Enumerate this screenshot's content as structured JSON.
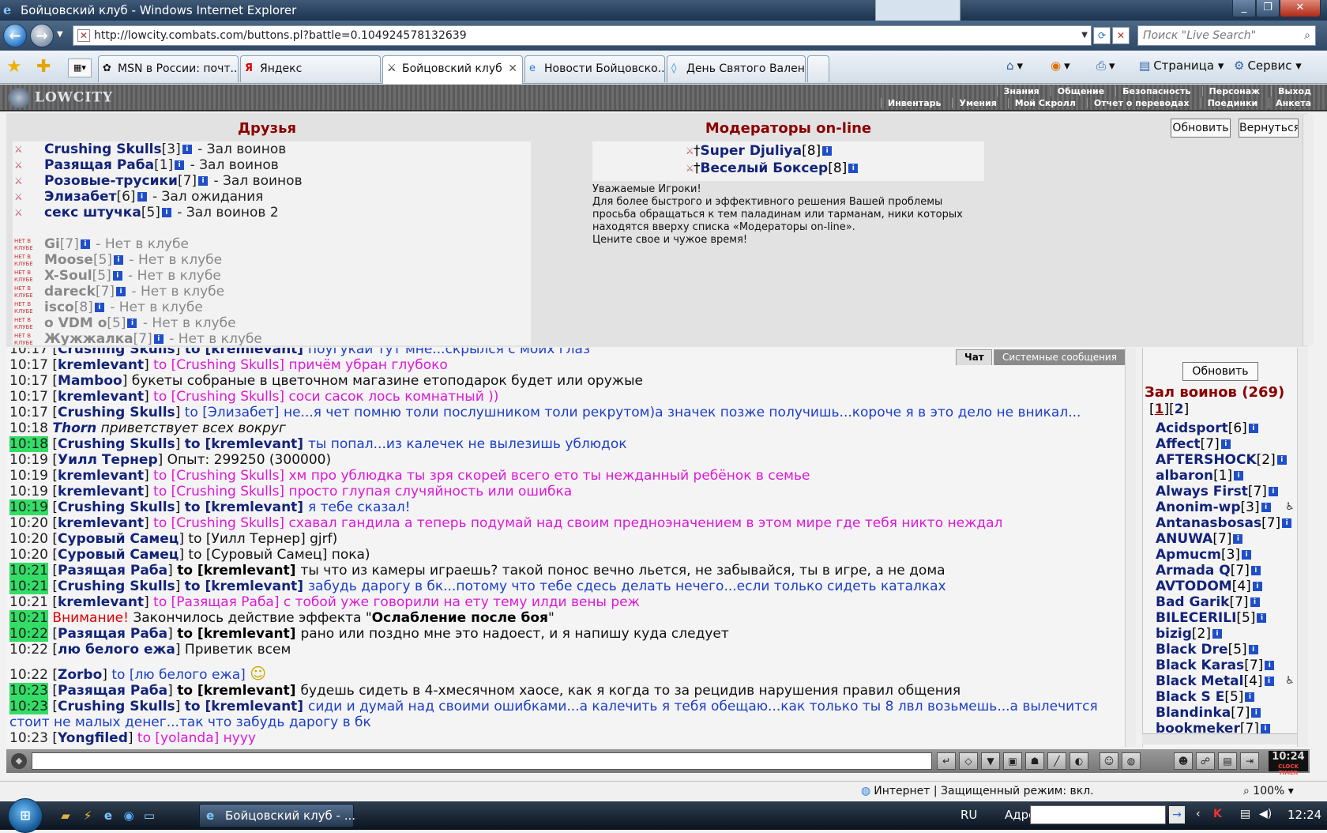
{
  "window": {
    "title": "Бойцовский клуб - Windows Internet Explorer",
    "url": "http://lowcity.combats.com/buttons.pl?battle=0.104924578132639",
    "search_placeholder": "Поиск \"Live Search\""
  },
  "tabs": [
    {
      "label": "MSN в России: почт...",
      "icon": "msn-icon"
    },
    {
      "label": "Яндекс",
      "icon": "yandex-icon"
    },
    {
      "label": "Бойцовский клуб",
      "icon": "combats-icon"
    },
    {
      "label": "Новости Бойцовско...",
      "icon": "ie-icon"
    },
    {
      "label": "День Святого Вален...",
      "icon": "ie-icon"
    }
  ],
  "commands": {
    "page": "Страница",
    "service": "Сервис"
  },
  "game": {
    "logo": "LOWCITY",
    "menu_row1": [
      "Знания",
      "Общение",
      "Безопасность",
      "Персонаж",
      "Выход"
    ],
    "menu_row2": [
      "Инвентарь",
      "Умения",
      "Мой Скролл",
      "Отчет о переводах",
      "Поединки",
      "Анкета"
    ]
  },
  "friends": {
    "title": "Друзья",
    "online": [
      {
        "name": "Crushing Skulls",
        "level": "[3]",
        "status": " - Зал воинов"
      },
      {
        "name": "Разящая Раба",
        "level": "[1]",
        "status": " - Зал воинов"
      },
      {
        "name": "Розовые-трусики",
        "level": "[7]",
        "status": " - Зал воинов"
      },
      {
        "name": "Элизабет",
        "level": "[6]",
        "status": " - Зал ожидания"
      },
      {
        "name": "секс штучка",
        "level": "[5]",
        "status": " - Зал воинов 2"
      }
    ],
    "offline": [
      {
        "name": "Gi",
        "level": "[7]",
        "status": " - Нет в клубе"
      },
      {
        "name": "Moose",
        "level": "[5]",
        "status": " - Нет в клубе"
      },
      {
        "name": "X-Soul",
        "level": "[5]",
        "status": " - Нет в клубе"
      },
      {
        "name": "dareck",
        "level": "[7]",
        "status": " - Нет в клубе"
      },
      {
        "name": "isco",
        "level": "[8]",
        "status": " - Нет в клубе"
      },
      {
        "name": "o VDM o",
        "level": "[5]",
        "status": " - Нет в клубе"
      },
      {
        "name": "Жужжалка",
        "level": "[7]",
        "status": " - Нет в клубе"
      }
    ]
  },
  "moderators": {
    "title": "Модераторы on-line",
    "list": [
      {
        "name": "Super Djuliya",
        "level": "[8]"
      },
      {
        "name": "Веселый Боксер",
        "level": "[8]"
      }
    ],
    "notice": [
      "Уважаемые Игроки!",
      "Для более быстрого и эффективного решения Вашей проблемы",
      "просьба обращаться к тем паладинам или тарманам, ники которых",
      "находятся вверху списка «Модераторы on-line».",
      "Цените свое и чужое время!"
    ]
  },
  "buttons": {
    "update": "Обновить",
    "return": "Вернуться"
  },
  "chat_tabs": {
    "chat": "Чат",
    "system": "Системные сообщения"
  },
  "chat": [
    {
      "t": "10:17",
      "hl": false,
      "parts": [
        [
          "[",
          "txt"
        ],
        [
          "Crushing Skulls",
          "nm"
        ],
        [
          "] ",
          "txt"
        ],
        [
          "to [kremlevant] ",
          "nmb"
        ],
        [
          "поугукай тут мне...скрылся с моих глаз",
          "blue"
        ]
      ]
    },
    {
      "t": "10:17",
      "hl": false,
      "parts": [
        [
          "[",
          "txt"
        ],
        [
          "kremlevant",
          "nm"
        ],
        [
          "] ",
          "txt"
        ],
        [
          "to [Crushing Skulls] причём убран глубоко",
          "pink"
        ]
      ]
    },
    {
      "t": "10:17",
      "hl": false,
      "parts": [
        [
          "[",
          "txt"
        ],
        [
          "Mamboo",
          "nm"
        ],
        [
          "] букеты собраные в цветочном магазине етоподарок будет или оружые",
          "txt"
        ]
      ]
    },
    {
      "t": "10:17",
      "hl": false,
      "parts": [
        [
          "[",
          "txt"
        ],
        [
          "kremlevant",
          "nm"
        ],
        [
          "] ",
          "txt"
        ],
        [
          "to [Crushing Skulls] соси сасок лось комнатный ))",
          "pink"
        ]
      ]
    },
    {
      "t": "10:17",
      "hl": false,
      "parts": [
        [
          "[",
          "txt"
        ],
        [
          "Crushing Skulls",
          "nm"
        ],
        [
          "] ",
          "txt"
        ],
        [
          "to [Элизабет] не...я чет помню толи послушником толи рекрутом)а значек позже получишь...короче я в это дело не вникал...",
          "blue"
        ]
      ]
    },
    {
      "t": "10:18",
      "hl": false,
      "parts": [
        [
          "Thorn",
          "nmi"
        ],
        [
          " приветствует всех вокруг",
          "it"
        ]
      ]
    },
    {
      "t": "10:18",
      "hl": true,
      "parts": [
        [
          "[",
          "txt"
        ],
        [
          "Crushing Skulls",
          "nm"
        ],
        [
          "] ",
          "txt"
        ],
        [
          "to [kremlevant] ",
          "nmb"
        ],
        [
          "ты попал...из калечек не вылезишь ублюдок",
          "blue"
        ]
      ]
    },
    {
      "t": "10:19",
      "hl": false,
      "parts": [
        [
          "[",
          "txt"
        ],
        [
          "Уилл Тернер",
          "nm"
        ],
        [
          "] Опыт: 299250 (300000)",
          "txt"
        ]
      ]
    },
    {
      "t": "10:19",
      "hl": false,
      "parts": [
        [
          "[",
          "txt"
        ],
        [
          "kremlevant",
          "nm"
        ],
        [
          "] ",
          "txt"
        ],
        [
          "to [Crushing Skulls] хм про ублюдка ты зря скорей всего ето ты нежданный ребёнок в семье",
          "pink"
        ]
      ]
    },
    {
      "t": "10:19",
      "hl": false,
      "parts": [
        [
          "[",
          "txt"
        ],
        [
          "kremlevant",
          "nm"
        ],
        [
          "] ",
          "txt"
        ],
        [
          "to [Crushing Skulls] просто глупая случяйность или ошибка",
          "pink"
        ]
      ]
    },
    {
      "t": "10:19",
      "hl": true,
      "parts": [
        [
          "[",
          "txt"
        ],
        [
          "Crushing Skulls",
          "nm"
        ],
        [
          "] ",
          "txt"
        ],
        [
          "to [kremlevant] ",
          "nmb"
        ],
        [
          "я тебе сказал!",
          "blue"
        ]
      ]
    },
    {
      "t": "10:20",
      "hl": false,
      "parts": [
        [
          "[",
          "txt"
        ],
        [
          "kremlevant",
          "nm"
        ],
        [
          "] ",
          "txt"
        ],
        [
          "to [Crushing Skulls] схавал гандила а теперь подумай над своим предноэначением в этом мире где тебя никто неждал",
          "pink"
        ]
      ]
    },
    {
      "t": "10:20",
      "hl": false,
      "parts": [
        [
          "[",
          "txt"
        ],
        [
          "Суровый Самец",
          "nm"
        ],
        [
          "] to [Уилл Тернер] gjrf)",
          "txt"
        ]
      ]
    },
    {
      "t": "10:20",
      "hl": false,
      "parts": [
        [
          "[",
          "txt"
        ],
        [
          "Суровый Самец",
          "nm"
        ],
        [
          "] to [Суровый Самец] пока)",
          "txt"
        ]
      ]
    },
    {
      "t": "10:21",
      "hl": true,
      "parts": [
        [
          "[",
          "txt"
        ],
        [
          "Разящая Раба",
          "nm"
        ],
        [
          "] ",
          "txt"
        ],
        [
          "to [kremlevant] ",
          "bold"
        ],
        [
          "ты что из камеры играешь? такой понос вечно льется, не забывайся, ты в игре, а не дома",
          "txt"
        ]
      ]
    },
    {
      "t": "10:21",
      "hl": true,
      "parts": [
        [
          "[",
          "txt"
        ],
        [
          "Crushing Skulls",
          "nm"
        ],
        [
          "] ",
          "txt"
        ],
        [
          "to [kremlevant] ",
          "nmb"
        ],
        [
          "забудь дарогу в бк...потому что тебе сдесь делать нечего...если только сидеть каталках",
          "blue"
        ]
      ]
    },
    {
      "t": "10:21",
      "hl": false,
      "parts": [
        [
          "[",
          "txt"
        ],
        [
          "kremlevant",
          "nm"
        ],
        [
          "] ",
          "txt"
        ],
        [
          "to [Разящая Раба] с тобой уже говорили на ету тему илди вены реж",
          "pink"
        ]
      ]
    },
    {
      "t": "10:21",
      "hl": true,
      "parts": [
        [
          "Внимание! ",
          "red"
        ],
        [
          "Закончилось действие эффекта \"",
          "txt"
        ],
        [
          "Ослабление после боя",
          "bold"
        ],
        [
          "\"",
          "txt"
        ]
      ]
    },
    {
      "t": "10:22",
      "hl": true,
      "parts": [
        [
          "[",
          "txt"
        ],
        [
          "Разящая Раба",
          "nm"
        ],
        [
          "] ",
          "txt"
        ],
        [
          "to [kremlevant] ",
          "bold"
        ],
        [
          "рано или поздно мне это надоест, и я напишу куда следует",
          "txt"
        ]
      ]
    },
    {
      "t": "10:22",
      "hl": false,
      "parts": [
        [
          "[",
          "txt"
        ],
        [
          "лю белого ежа",
          "nm"
        ],
        [
          "] Приветик всем",
          "txt"
        ]
      ]
    },
    {
      "t": "10:22",
      "hl": false,
      "tall": true,
      "smiley": true,
      "parts": [
        [
          "[",
          "txt"
        ],
        [
          "Zorbo",
          "nm"
        ],
        [
          "] ",
          "txt"
        ],
        [
          "to [лю белого ежа] ",
          "blue"
        ]
      ]
    },
    {
      "t": "10:23",
      "hl": true,
      "parts": [
        [
          "[",
          "txt"
        ],
        [
          "Разящая Раба",
          "nm"
        ],
        [
          "] ",
          "txt"
        ],
        [
          "to [kremlevant] ",
          "bold"
        ],
        [
          "будешь сидеть в 4-хмесячном хаосе, как я когда то за рецидив нарушения правил общения",
          "txt"
        ]
      ]
    },
    {
      "t": "10:23",
      "hl": true,
      "wrap": true,
      "parts": [
        [
          "[",
          "txt"
        ],
        [
          "Crushing Skulls",
          "nm"
        ],
        [
          "] ",
          "txt"
        ],
        [
          "to [kremlevant] ",
          "nmb"
        ],
        [
          "сиди и думай над своими ошибками...а калечить я тебя обещаю...как только ты 8 лвл возьмешь...а вылечится стоит не малых денег...так что забудь дарогу в бк",
          "blue"
        ]
      ]
    },
    {
      "t": "10:23",
      "hl": false,
      "parts": [
        [
          "[",
          "txt"
        ],
        [
          "Yongfiled",
          "nm"
        ],
        [
          "] ",
          "txt"
        ],
        [
          "to [yolanda] нууу",
          "pink"
        ]
      ]
    }
  ],
  "hall": {
    "title": "Зал воинов (269)",
    "pages": [
      "1",
      "2"
    ],
    "players": [
      {
        "name": "Acidsport",
        "level": "[6]"
      },
      {
        "name": "Affect",
        "level": "[7]"
      },
      {
        "name": "AFTERSHOCK",
        "level": "[2]"
      },
      {
        "name": "albaron",
        "level": "[1]"
      },
      {
        "name": "Always First",
        "level": "[7]"
      },
      {
        "name": "Anonim-wp",
        "level": "[3]",
        "extra": "♿"
      },
      {
        "name": "Antanasbosas",
        "level": "[7]"
      },
      {
        "name": "ANUWA",
        "level": "[7]"
      },
      {
        "name": "Apmucm",
        "level": "[3]"
      },
      {
        "name": "Armada Q",
        "level": "[7]"
      },
      {
        "name": "AVTODOM",
        "level": "[4]"
      },
      {
        "name": "Bad Garik",
        "level": "[7]"
      },
      {
        "name": "BILECERILI",
        "level": "[5]"
      },
      {
        "name": "bizig",
        "level": "[2]"
      },
      {
        "name": "Black Dre",
        "level": "[5]"
      },
      {
        "name": "Black Karas",
        "level": "[7]"
      },
      {
        "name": "Black Metal",
        "level": "[4]",
        "extra": "♿"
      },
      {
        "name": "Black S E",
        "level": "[5]"
      },
      {
        "name": "Blandinka",
        "level": "[7]"
      },
      {
        "name": "bookmeker",
        "level": "[7]"
      }
    ]
  },
  "clock": {
    "time": "10:24",
    "labels": "CLOCK TIMER"
  },
  "statusbar": {
    "zone": "Интернет | Защищенный режим: вкл.",
    "zoom": "100%"
  },
  "taskbar": {
    "task": "Бойцовский клуб - ...",
    "lang": "RU",
    "address_label": "Адрес",
    "time": "12:24"
  },
  "colors": {
    "highlight": "#33dd66",
    "private_to_me": "#dd18d8",
    "private_blue": "#1c3ec8",
    "name": "#13237a",
    "title_red": "#8b0000"
  }
}
